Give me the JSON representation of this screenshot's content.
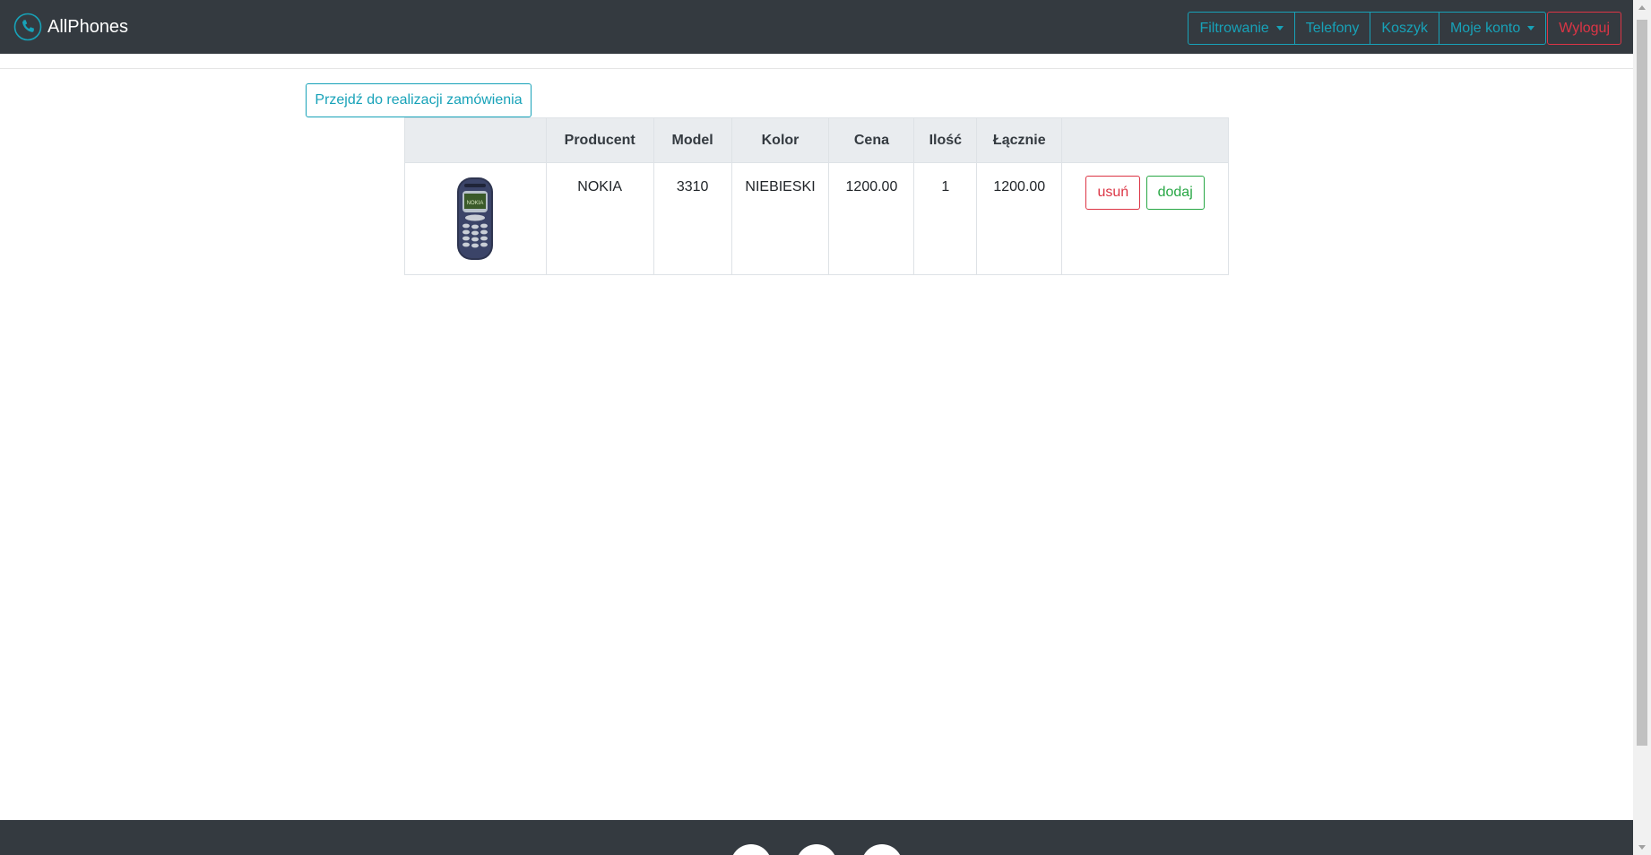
{
  "app": {
    "brand": "AllPhones",
    "logo_icon": "phone-icon"
  },
  "nav": {
    "filter_label": "Filtrowanie",
    "phones_label": "Telefony",
    "cart_label": "Koszyk",
    "account_label": "Moje konto",
    "logout_label": "Wyloguj"
  },
  "checkout": {
    "label": "Przejdź do realizacji zamówienia"
  },
  "table": {
    "headers": [
      "",
      "Producent",
      "Model",
      "Kolor",
      "Cena",
      "Ilość",
      "Łącznie",
      ""
    ],
    "rows": [
      {
        "image_icon": "nokia-3310-phone-image",
        "producer": "NOKIA",
        "model": "3310",
        "color": "NIEBIESKI",
        "price": "1200.00",
        "quantity": "1",
        "total": "1200.00",
        "remove_label": "usuń",
        "add_label": "dodaj"
      }
    ]
  },
  "colors": {
    "navbar": "#343a40",
    "info": "#17a2b8",
    "danger": "#dc3545",
    "success": "#28a745",
    "table_head": "#e9ecef"
  }
}
